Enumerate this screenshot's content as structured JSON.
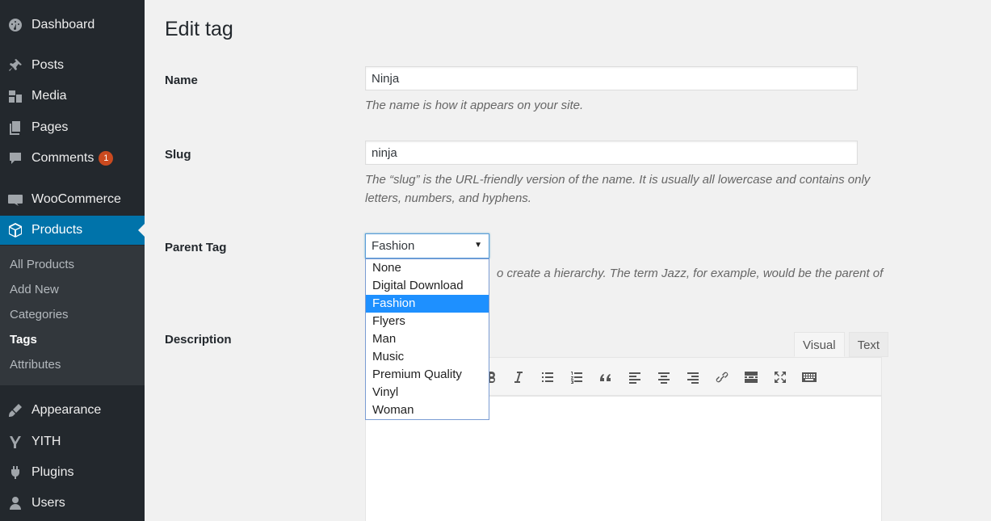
{
  "sidebar": {
    "dashboard": "Dashboard",
    "posts": "Posts",
    "media": "Media",
    "pages": "Pages",
    "comments": "Comments",
    "comments_badge": "1",
    "woocommerce": "WooCommerce",
    "products": "Products",
    "submenu": [
      "All Products",
      "Add New",
      "Categories",
      "Tags",
      "Attributes"
    ],
    "appearance": "Appearance",
    "yith": "YITH",
    "plugins": "Plugins",
    "users": "Users"
  },
  "page": {
    "title": "Edit tag"
  },
  "form": {
    "name_label": "Name",
    "name_value": "Ninja",
    "name_hint": "The name is how it appears on your site.",
    "slug_label": "Slug",
    "slug_value": "ninja",
    "slug_hint_1": "The “slug” is the URL-friendly version of the name. It is usually all lowercase and contains only",
    "slug_hint_2": "letters, numbers, and hyphens.",
    "parent_label": "Parent Tag",
    "parent_selected": "Fashion",
    "parent_hint": "o create a hierarchy. The term Jazz, for example, would be the parent of",
    "parent_options": [
      "None",
      "Digital Download",
      "Fashion",
      "Flyers",
      "Man",
      "Music",
      "Premium Quality",
      "Vinyl",
      "Woman"
    ],
    "description_label": "Description"
  },
  "editor": {
    "tab_visual": "Visual",
    "tab_text": "Text"
  },
  "icons": [
    "dashboard-icon",
    "posts-icon",
    "media-icon",
    "pages-icon",
    "comments-icon",
    "woocommerce-icon",
    "products-icon",
    "appearance-icon",
    "yith-icon",
    "plugins-icon",
    "users-icon",
    "bold-icon",
    "italic-icon",
    "bullet-list-icon",
    "numbered-list-icon",
    "blockquote-icon",
    "align-left-icon",
    "align-center-icon",
    "align-right-icon",
    "link-icon",
    "read-more-icon",
    "fullscreen-icon",
    "toolbar-toggle-icon"
  ],
  "colors": {
    "sidebar_bg": "#23282d",
    "submenu_bg": "#32373c",
    "active_menu": "#0073aa",
    "badge": "#ca4a1f",
    "selected_option": "#1e90ff"
  }
}
